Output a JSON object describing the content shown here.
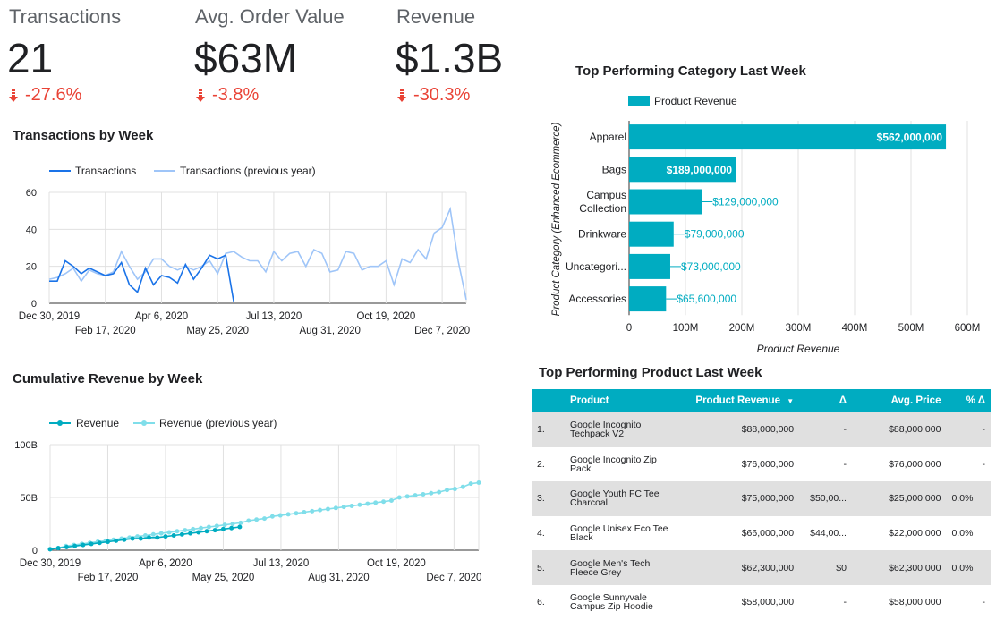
{
  "kpis": [
    {
      "label": "Transactions",
      "value": "21",
      "delta": "-27.6%"
    },
    {
      "label": "Avg. Order Value",
      "value": "$63M",
      "delta": "-3.8%"
    },
    {
      "label": "Revenue",
      "value": "$1.3B",
      "delta": "-30.3%"
    }
  ],
  "colors": {
    "negative": "#e94235",
    "primary": "#1a73e8",
    "primary_light": "#9fc5f8",
    "teal": "#00acc1",
    "teal_light": "#80deea"
  },
  "transactions_chart": {
    "title": "Transactions by Week",
    "legend": [
      "Transactions",
      "Transactions (previous year)"
    ]
  },
  "revenue_chart": {
    "title": "Cumulative Revenue by Week",
    "legend": [
      "Revenue",
      "Revenue (previous year)"
    ]
  },
  "category_chart": {
    "title": "Top Performing Category Last Week",
    "legend": [
      "Product Revenue"
    ],
    "xlabel": "Product Revenue",
    "ylabel": "Product Category (Enhanced Ecommerce)"
  },
  "product_table": {
    "title": "Top Performing Product Last Week",
    "headers": [
      "Product",
      "Product Revenue",
      "Δ",
      "Avg. Price",
      "% Δ"
    ],
    "sort_icon": "sort-desc-icon",
    "rows": [
      {
        "rank": "1.",
        "product_line1": "Google Incognito",
        "product_line2": "Techpack V2",
        "revenue": "$88,000,000",
        "delta": "-",
        "avg_price": "$88,000,000",
        "pct_delta": "-"
      },
      {
        "rank": "2.",
        "product_line1": "Google Incognito Zip",
        "product_line2": "Pack",
        "revenue": "$76,000,000",
        "delta": "-",
        "avg_price": "$76,000,000",
        "pct_delta": "-"
      },
      {
        "rank": "3.",
        "product_line1": "Google Youth FC Tee",
        "product_line2": "Charcoal",
        "revenue": "$75,000,000",
        "delta": "$50,00...",
        "avg_price": "$25,000,000",
        "pct_delta": "0.0%"
      },
      {
        "rank": "4.",
        "product_line1": "Google Unisex Eco Tee",
        "product_line2": "Black",
        "revenue": "$66,000,000",
        "delta": "$44,00...",
        "avg_price": "$22,000,000",
        "pct_delta": "0.0%"
      },
      {
        "rank": "5.",
        "product_line1": "Google Men's Tech",
        "product_line2": "Fleece Grey",
        "revenue": "$62,300,000",
        "delta": "$0",
        "avg_price": "$62,300,000",
        "pct_delta": "0.0%"
      },
      {
        "rank": "6.",
        "product_line1": "Google Sunnyvale",
        "product_line2": "Campus Zip Hoodie",
        "revenue": "$58,000,000",
        "delta": "-",
        "avg_price": "$58,000,000",
        "pct_delta": "-"
      }
    ]
  },
  "chart_data": [
    {
      "type": "line",
      "title": "Transactions by Week",
      "xlabel": "",
      "ylabel": "",
      "ylim": [
        0,
        60
      ],
      "y_ticks": [
        "0",
        "20",
        "40",
        "60"
      ],
      "x_tick_labels_row1": [
        "Dec 30, 2019",
        "Apr 6, 2020",
        "Jul 13, 2020",
        "Oct 19, 2020"
      ],
      "x_tick_labels_row2": [
        "Feb 17, 2020",
        "May 25, 2020",
        "Aug 31, 2020",
        "Dec 7, 2020"
      ],
      "x_week_count": 53,
      "grid": true,
      "legend_position": "top",
      "series": [
        {
          "name": "Transactions",
          "values": [
            12,
            12,
            23,
            20,
            16,
            19,
            17,
            15,
            16,
            22,
            10,
            6,
            19,
            10,
            15,
            14,
            11,
            21,
            13,
            19,
            26,
            24,
            26,
            1
          ]
        },
        {
          "name": "Transactions (previous year)",
          "values": [
            13,
            14,
            16,
            19,
            12,
            18,
            16,
            15,
            17,
            28,
            20,
            13,
            17,
            24,
            24,
            20,
            18,
            20,
            18,
            20,
            23,
            16,
            27,
            28,
            25,
            23,
            23,
            17,
            28,
            23,
            27,
            28,
            20,
            29,
            27,
            17,
            18,
            28,
            27,
            18,
            20,
            20,
            23,
            10,
            24,
            22,
            29,
            24,
            38,
            41,
            51,
            23,
            2
          ]
        }
      ]
    },
    {
      "type": "line",
      "title": "Cumulative Revenue by Week",
      "xlabel": "",
      "ylabel": "",
      "ylim": [
        0,
        100
      ],
      "y_unit": "B",
      "y_ticks": [
        "0",
        "50B",
        "100B"
      ],
      "x_tick_labels_row1": [
        "Dec 30, 2019",
        "Apr 6, 2020",
        "Jul 13, 2020",
        "Oct 19, 2020"
      ],
      "x_tick_labels_row2": [
        "Feb 17, 2020",
        "May 25, 2020",
        "Aug 31, 2020",
        "Dec 7, 2020"
      ],
      "x_week_count": 53,
      "grid": true,
      "legend_position": "top",
      "series": [
        {
          "name": "Revenue",
          "values": [
            1,
            2,
            3,
            4,
            5,
            6,
            7,
            8,
            9,
            10,
            11,
            11,
            12,
            12,
            13,
            14,
            15,
            16,
            17,
            18,
            19,
            20,
            21,
            22
          ]
        },
        {
          "name": "Revenue (previous year)",
          "values": [
            1,
            2,
            4,
            5,
            6,
            7,
            8,
            9,
            10,
            11,
            12,
            13,
            14,
            15,
            16,
            17,
            18,
            19,
            20,
            21,
            22,
            23,
            24,
            25,
            26,
            28,
            29,
            30,
            32,
            33,
            34,
            35,
            36,
            37,
            38,
            39,
            40,
            41,
            42,
            43,
            44,
            45,
            46,
            47,
            50,
            51,
            52,
            53,
            54,
            55,
            57,
            58,
            60,
            63,
            64
          ]
        }
      ]
    },
    {
      "type": "bar",
      "orientation": "horizontal",
      "title": "Top Performing Category Last Week",
      "xlabel": "Product Revenue",
      "ylabel": "Product Category (Enhanced Ecommerce)",
      "categories": [
        "Apparel",
        "Bags",
        "Campus Collection",
        "Drinkware",
        "Uncategori...",
        "Accessories"
      ],
      "series": [
        {
          "name": "Product Revenue",
          "values": [
            562000000,
            189000000,
            129000000,
            79000000,
            73000000,
            65600000
          ]
        }
      ],
      "data_labels": [
        "$562,000,000",
        "$189,000,000",
        "$129,000,000",
        "$79,000,000",
        "$73,000,000",
        "$65,600,000"
      ],
      "xlim": [
        0,
        600000000
      ],
      "x_ticks": [
        "0",
        "100M",
        "200M",
        "300M",
        "400M",
        "500M",
        "600M"
      ],
      "grid": true,
      "legend_position": "top"
    }
  ]
}
